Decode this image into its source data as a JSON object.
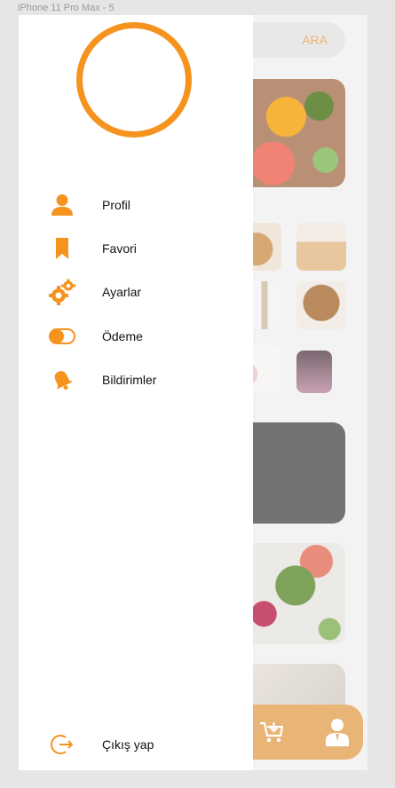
{
  "frame": {
    "label": "iPhone 11 Pro Max - 5"
  },
  "search": {
    "button_label": "ARA"
  },
  "drawer": {
    "menu": {
      "profil": "Profil",
      "favori": "Favori",
      "ayarlar": "Ayarlar",
      "odeme": "Ödeme",
      "bildirimler": "Bildirimler"
    },
    "logout": "Çıkış yap"
  },
  "colors": {
    "accent": "#f5931e",
    "nav_background": "#e8b576",
    "drawer_background": "#ffffff",
    "page_background": "#e6e6e6"
  },
  "icons": {
    "profil": "person-icon",
    "favori": "bookmark-icon",
    "ayarlar": "gears-icon",
    "odeme": "toggle-icon",
    "bildirimler": "bell-icon",
    "logout": "logout-icon",
    "cart": "cart-icon",
    "account": "person-icon"
  }
}
